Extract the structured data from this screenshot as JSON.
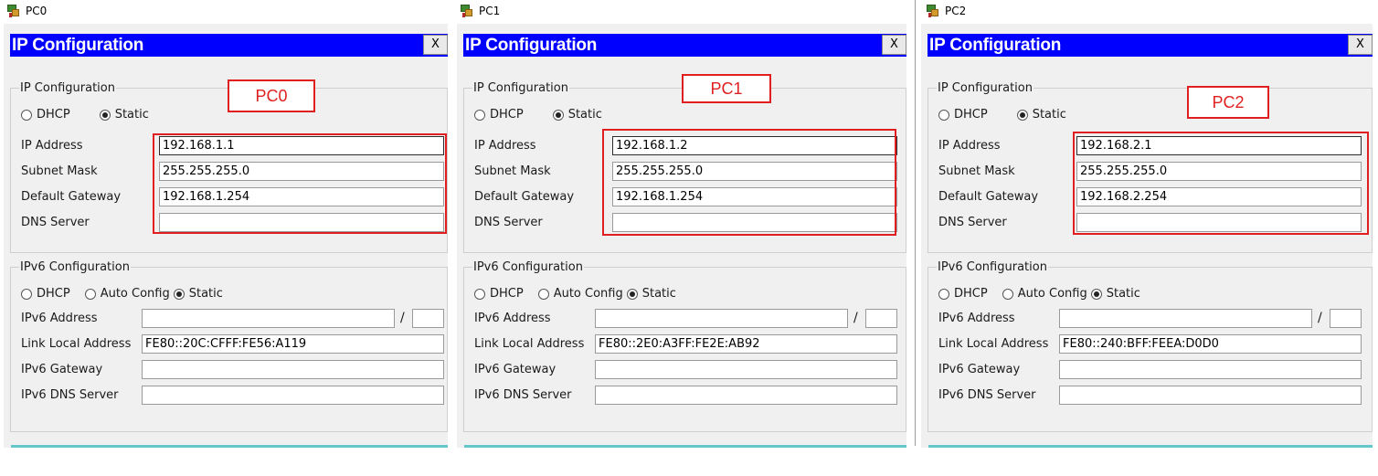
{
  "windows": [
    {
      "window_title": "PC0",
      "header_title": "IP Configuration",
      "close_label": "X",
      "tag": "PC0",
      "ipv4": {
        "legend": "IP Configuration",
        "dhcp_label": "DHCP",
        "static_label": "Static",
        "mode": "static",
        "ip_label": "IP Address",
        "ip": "192.168.1.1",
        "mask_label": "Subnet Mask",
        "mask": "255.255.255.0",
        "gateway_label": "Default Gateway",
        "gateway": "192.168.1.254",
        "dns_label": "DNS Server",
        "dns": ""
      },
      "ipv6": {
        "legend": "IPv6 Configuration",
        "dhcp_label": "DHCP",
        "auto_label": "Auto Config",
        "static_label": "Static",
        "mode": "static",
        "address_label": "IPv6 Address",
        "address": "",
        "slash": "/",
        "prefix": "",
        "link_local_label": "Link Local Address",
        "link_local": "FE80::20C:CFFF:FE56:A119",
        "gateway_label": "IPv6 Gateway",
        "gateway": "",
        "dns_label": "IPv6 DNS Server",
        "dns": ""
      }
    },
    {
      "window_title": "PC1",
      "header_title": "IP Configuration",
      "close_label": "X",
      "tag": "PC1",
      "ipv4": {
        "legend": "IP Configuration",
        "dhcp_label": "DHCP",
        "static_label": "Static",
        "mode": "static",
        "ip_label": "IP Address",
        "ip": "192.168.1.2",
        "mask_label": "Subnet Mask",
        "mask": "255.255.255.0",
        "gateway_label": "Default Gateway",
        "gateway": "192.168.1.254",
        "dns_label": "DNS Server",
        "dns": ""
      },
      "ipv6": {
        "legend": "IPv6 Configuration",
        "dhcp_label": "DHCP",
        "auto_label": "Auto Config",
        "static_label": "Static",
        "mode": "static",
        "address_label": "IPv6 Address",
        "address": "",
        "slash": "/",
        "prefix": "",
        "link_local_label": "Link Local Address",
        "link_local": "FE80::2E0:A3FF:FE2E:AB92",
        "gateway_label": "IPv6 Gateway",
        "gateway": "",
        "dns_label": "IPv6 DNS Server",
        "dns": ""
      }
    },
    {
      "window_title": "PC2",
      "header_title": "IP Configuration",
      "close_label": "X",
      "tag": "PC2",
      "ipv4": {
        "legend": "IP Configuration",
        "dhcp_label": "DHCP",
        "static_label": "Static",
        "mode": "static",
        "ip_label": "IP Address",
        "ip": "192.168.2.1",
        "mask_label": "Subnet Mask",
        "mask": "255.255.255.0",
        "gateway_label": "Default Gateway",
        "gateway": "192.168.2.254",
        "dns_label": "DNS Server",
        "dns": ""
      },
      "ipv6": {
        "legend": "IPv6 Configuration",
        "dhcp_label": "DHCP",
        "auto_label": "Auto Config",
        "static_label": "Static",
        "mode": "static",
        "address_label": "IPv6 Address",
        "address": "",
        "slash": "/",
        "prefix": "",
        "link_local_label": "Link Local Address",
        "link_local": "FE80::240:BFF:FEEA:D0D0",
        "gateway_label": "IPv6 Gateway",
        "gateway": "",
        "dns_label": "IPv6 DNS Server",
        "dns": ""
      }
    }
  ],
  "colors": {
    "header_bg": "#0000ff",
    "header_text": "#ffffff",
    "annotation": "#e02020",
    "panel_bg": "#f0f0f0",
    "accent_line": "#65c7c9"
  }
}
